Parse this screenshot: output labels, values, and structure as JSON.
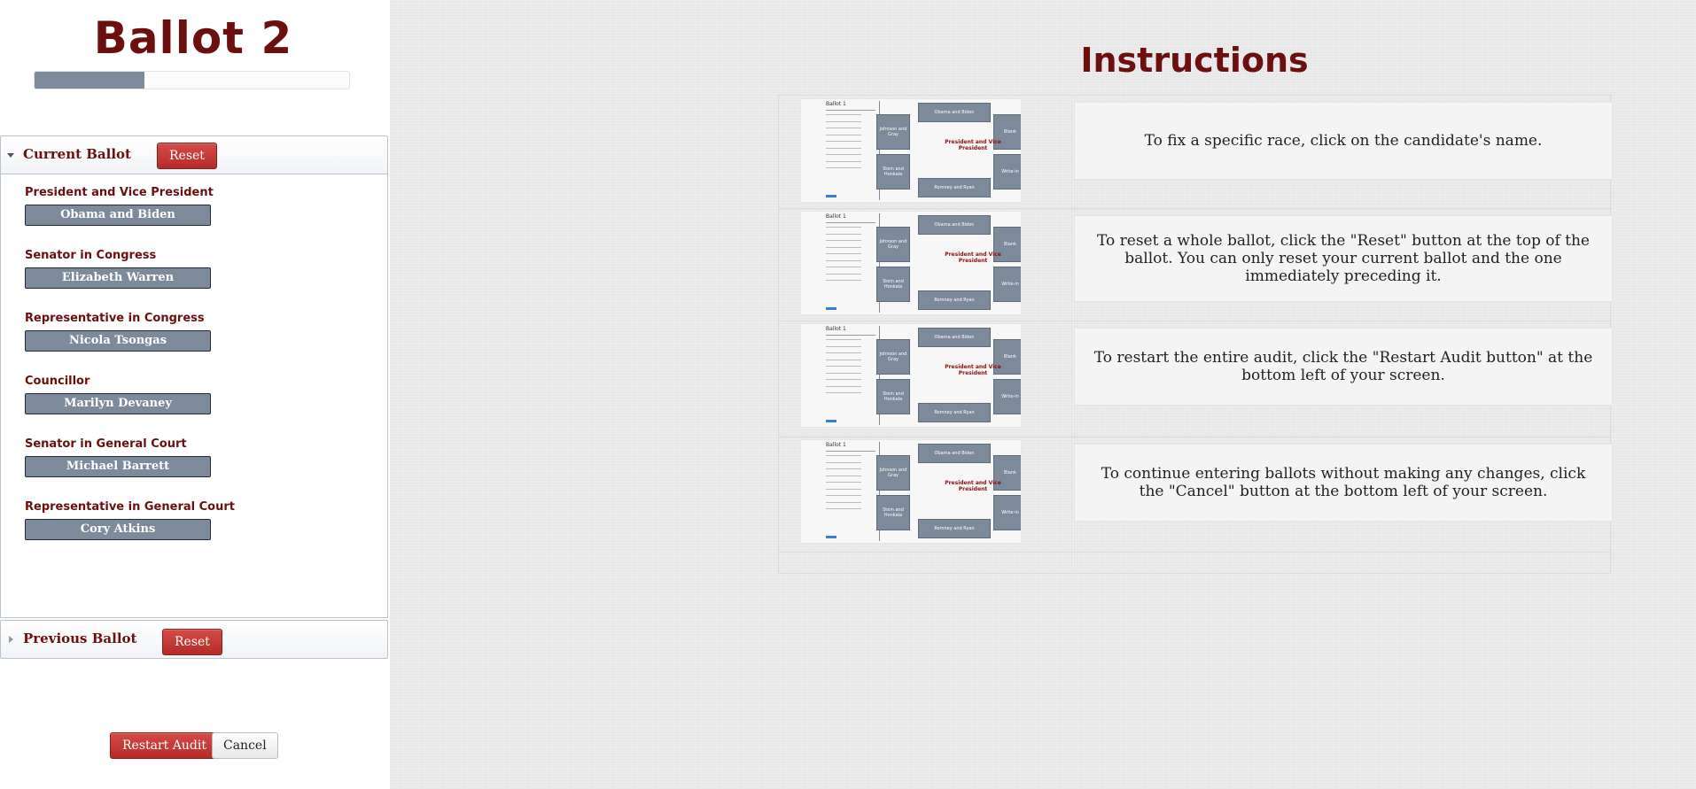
{
  "sidebar": {
    "title": "Ballot 2",
    "progress_fraction": 0.35,
    "current_ballot": {
      "label": "Current Ballot",
      "reset_label": "Reset",
      "races": [
        {
          "name": "President and Vice President",
          "candidate": "Obama and Biden"
        },
        {
          "name": "Senator in Congress",
          "candidate": "Elizabeth Warren"
        },
        {
          "name": "Representative in Congress",
          "candidate": "Nicola Tsongas"
        },
        {
          "name": "Councillor",
          "candidate": "Marilyn Devaney"
        },
        {
          "name": "Senator in General Court",
          "candidate": "Michael Barrett"
        },
        {
          "name": "Representative in General Court",
          "candidate": "Cory Atkins"
        }
      ]
    },
    "previous_ballot": {
      "label": "Previous Ballot",
      "reset_label": "Reset"
    },
    "restart_label": "Restart Audit",
    "cancel_label": "Cancel"
  },
  "instructions": {
    "title": "Instructions",
    "thumbnail": {
      "ballot_title": "Ballot 1",
      "race_label": "President and Vice President",
      "candidates": {
        "top": "Obama and Biden",
        "left_top": "Johnson and Gray",
        "right_top": "Blank",
        "left_bottom": "Stein and Honkala",
        "right_bottom": "Write-in",
        "bottom": "Romney and Ryan"
      }
    },
    "rows": [
      {
        "text": "To fix a specific race, click on the candidate's name."
      },
      {
        "text": "To reset a whole ballot, click the \"Reset\" button at the top of the ballot. You can only reset your current ballot and the one immediately preceding it."
      },
      {
        "text": "To restart the entire audit, click the \"Restart Audit button\" at the bottom left of your screen."
      },
      {
        "text": "To continue entering ballots without making any changes, click the \"Cancel\" button at the bottom left of your screen."
      }
    ]
  },
  "colors": {
    "title": "#6b0f0f",
    "candidate_button": "#7c8a9b",
    "reset_button": "#c0392b",
    "progress_fill": "#7c8a9b"
  }
}
